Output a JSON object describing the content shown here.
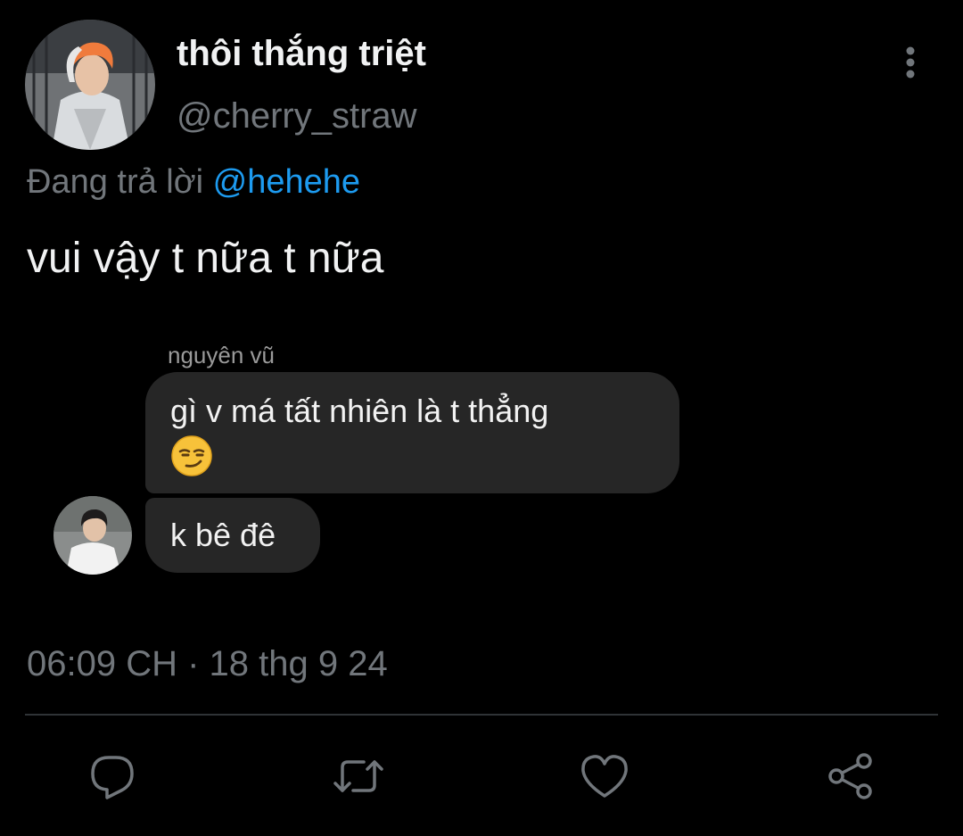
{
  "tweet": {
    "author": {
      "display_name": "thôi thắng triệt",
      "handle": "@cherry_straw",
      "avatar_icon": "profile-photo"
    },
    "reply_context": {
      "prefix": "Đang trả lời",
      "mention": "@hehehe"
    },
    "text": "vui vậy t nữa t nữa",
    "timestamp": "06:09 CH · 18 thg 9 24",
    "more_icon": "more-vertical-icon"
  },
  "screenshot": {
    "sender_name": "nguyên vũ",
    "messages": [
      {
        "text": "gì v má tất nhiên là t thẳng",
        "emoji": "smirking-face"
      },
      {
        "text": "k bê đê"
      }
    ]
  },
  "actions": [
    {
      "name": "reply",
      "icon": "reply-icon"
    },
    {
      "name": "retweet",
      "icon": "retweet-icon"
    },
    {
      "name": "like",
      "icon": "heart-icon"
    },
    {
      "name": "share",
      "icon": "share-icon"
    }
  ],
  "colors": {
    "background": "#000000",
    "primary_text": "#f1f2f3",
    "secondary_text": "#71767b",
    "mention": "#1d9bf0",
    "bubble": "#262626",
    "divider": "#2f3336"
  }
}
